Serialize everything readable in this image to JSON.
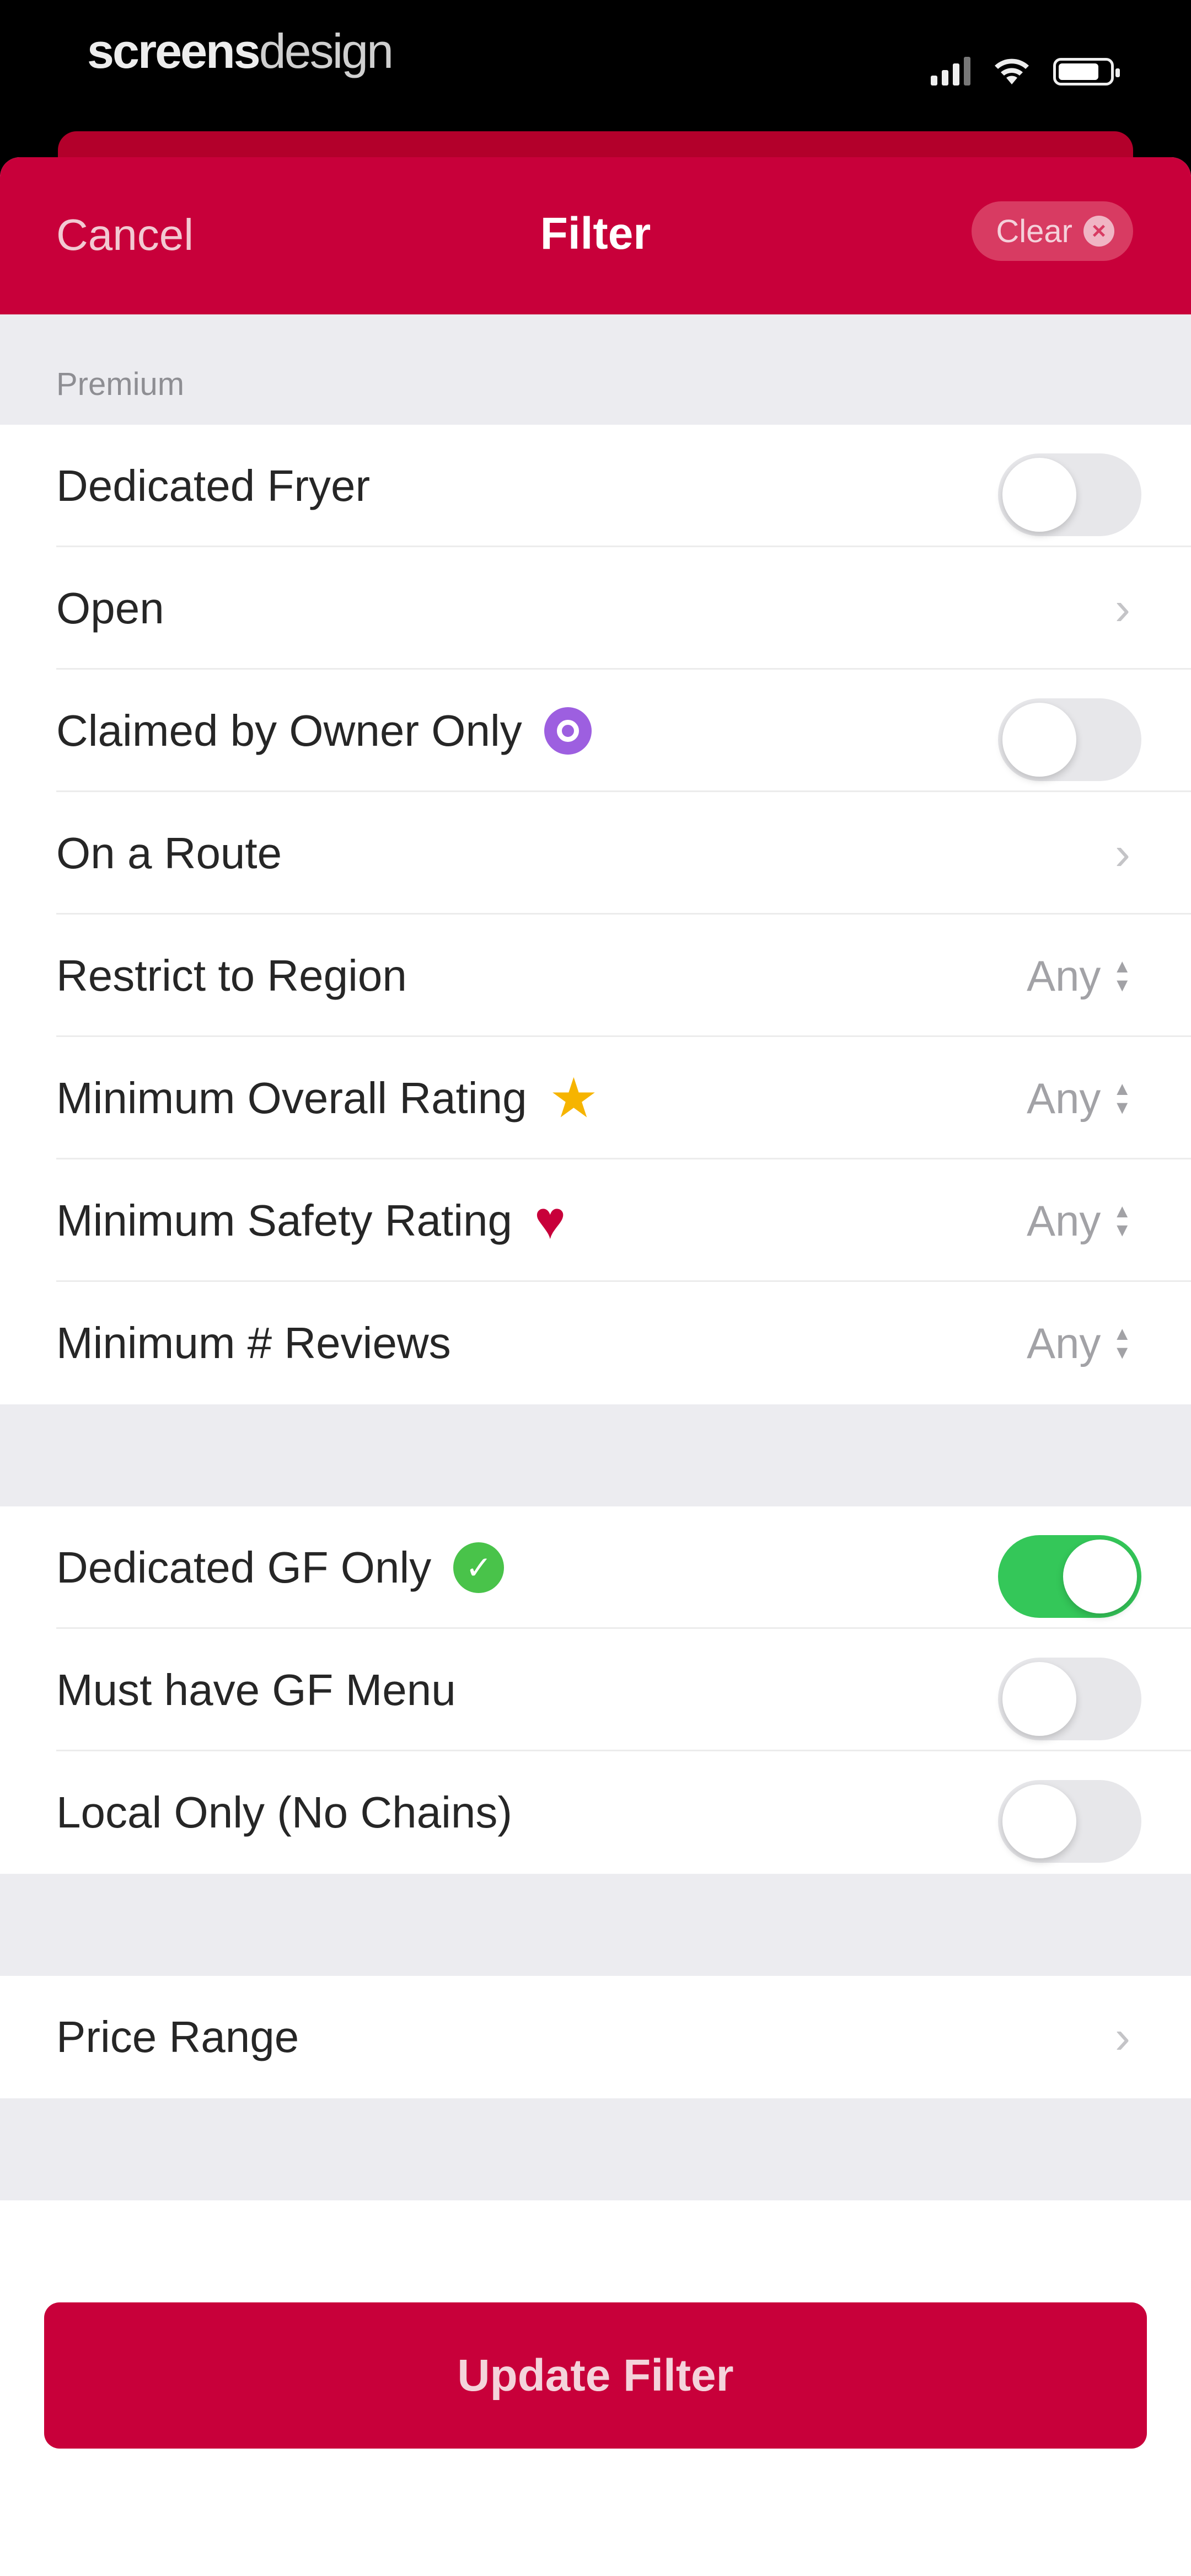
{
  "status_bar": {
    "brand_bold": "screens",
    "brand_light": "design",
    "signal_icon": "signal-icon",
    "wifi_icon": "wifi-icon",
    "battery_icon": "battery-icon"
  },
  "nav": {
    "cancel": "Cancel",
    "title": "Filter",
    "clear": "Clear",
    "clear_icon": "x-circle-icon"
  },
  "section_premium": {
    "title": "Premium",
    "rows": {
      "dedicated_fryer": {
        "label": "Dedicated Fryer",
        "toggle_on": false
      },
      "open": {
        "label": "Open"
      },
      "claimed": {
        "label": "Claimed by Owner Only",
        "icon": "purple-verified-icon",
        "toggle_on": false
      },
      "on_route": {
        "label": "On a Route"
      },
      "region": {
        "label": "Restrict to Region",
        "value": "Any"
      },
      "overall_rating": {
        "label": "Minimum Overall Rating",
        "icon": "star-icon",
        "value": "Any"
      },
      "safety_rating": {
        "label": "Minimum Safety Rating",
        "icon": "heart-icon",
        "value": "Any"
      },
      "reviews": {
        "label": "Minimum # Reviews",
        "value": "Any"
      }
    }
  },
  "section_gf": {
    "rows": {
      "dedicated_gf": {
        "label": "Dedicated GF Only",
        "icon": "green-check-icon",
        "toggle_on": true
      },
      "gf_menu": {
        "label": "Must have GF Menu",
        "toggle_on": false
      },
      "local_only": {
        "label": "Local Only (No Chains)",
        "toggle_on": false
      }
    }
  },
  "section_price": {
    "rows": {
      "price_range": {
        "label": "Price Range"
      }
    }
  },
  "footer": {
    "update_button": "Update Filter"
  },
  "colors": {
    "brand_red": "#c8003a",
    "toggle_on": "#34c759",
    "star": "#f6b400",
    "verified_purple": "#9d5fe0",
    "check_green": "#49c34a"
  }
}
